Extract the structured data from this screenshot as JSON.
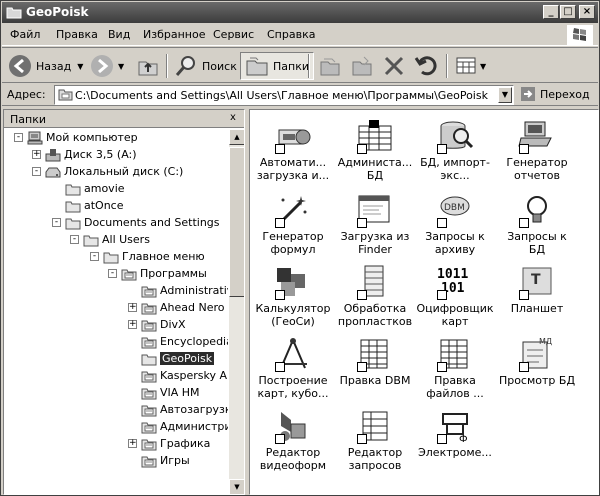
{
  "window": {
    "title": "GeoPoisk"
  },
  "menubar": {
    "items": [
      "Файл",
      "Правка",
      "Вид",
      "Избранное",
      "Сервис",
      "Справка"
    ]
  },
  "toolbar": {
    "back": "Назад",
    "search": "Поиск",
    "folders": "Папки"
  },
  "addressbar": {
    "label": "Адрес:",
    "value": "C:\\Documents and Settings\\All Users\\Главное меню\\Программы\\GeoPoisk",
    "go": "Переход"
  },
  "folders_pane": {
    "title": "Папки",
    "close": "x",
    "tree": [
      {
        "label": "Мой компьютер",
        "exp": "-"
      },
      {
        "label": "Диск 3,5 (A:)",
        "exp": "+"
      },
      {
        "label": "Локальный диск (C:)",
        "exp": "-"
      },
      {
        "label": "amovie",
        "exp": ""
      },
      {
        "label": "atOnce",
        "exp": ""
      },
      {
        "label": "Documents and Settings",
        "exp": "-"
      },
      {
        "label": "All Users",
        "exp": "-"
      },
      {
        "label": "Главное меню",
        "exp": "-"
      },
      {
        "label": "Программы",
        "exp": "-"
      },
      {
        "label": "Administrative",
        "exp": ""
      },
      {
        "label": "Ahead Nero",
        "exp": "+"
      },
      {
        "label": "DivX",
        "exp": "+"
      },
      {
        "label": "Encyclopedia",
        "exp": ""
      },
      {
        "label": "GeoPoisk",
        "exp": ""
      },
      {
        "label": "Kaspersky An",
        "exp": ""
      },
      {
        "label": "VIA HM",
        "exp": ""
      },
      {
        "label": "Автозагрузк",
        "exp": ""
      },
      {
        "label": "Администрир",
        "exp": ""
      },
      {
        "label": "Графика",
        "exp": "+"
      },
      {
        "label": "Игры",
        "exp": ""
      }
    ]
  },
  "files": [
    {
      "label": "Автомати... загрузка и...",
      "icon": "projector-icon"
    },
    {
      "label": "Администа... БД",
      "icon": "database-admin-icon"
    },
    {
      "label": "БД, импорт-экс...",
      "icon": "db-import-icon"
    },
    {
      "label": "Генератор отчетов",
      "icon": "computer-report-icon"
    },
    {
      "label": "Генератор формул",
      "icon": "magic-wand-icon"
    },
    {
      "label": "Загрузка из Finder",
      "icon": "window-icon"
    },
    {
      "label": "Запросы к архиву",
      "icon": "dbm-archive-icon"
    },
    {
      "label": "Запросы к БД",
      "icon": "lightbulb-icon"
    },
    {
      "label": "Калькулятор (ГеоСи)",
      "icon": "cubes-icon"
    },
    {
      "label": "Обработка пропластков",
      "icon": "layers-icon"
    },
    {
      "label": "Оцифровщик карт",
      "icon": "binary-icon"
    },
    {
      "label": "Планшет",
      "icon": "tablet-icon"
    },
    {
      "label": "Построение карт, кубо...",
      "icon": "compass-icon"
    },
    {
      "label": "Правка DBM",
      "icon": "grid-table-icon"
    },
    {
      "label": "Правка файлов ...",
      "icon": "grid-table-icon"
    },
    {
      "label": "Просмотр БД",
      "icon": "notebook-icon"
    },
    {
      "label": "Редактор видеоформ",
      "icon": "shapes-icon"
    },
    {
      "label": "Редактор запросов",
      "icon": "query-table-icon"
    },
    {
      "label": "Электроме...",
      "icon": "circuit-icon"
    }
  ]
}
